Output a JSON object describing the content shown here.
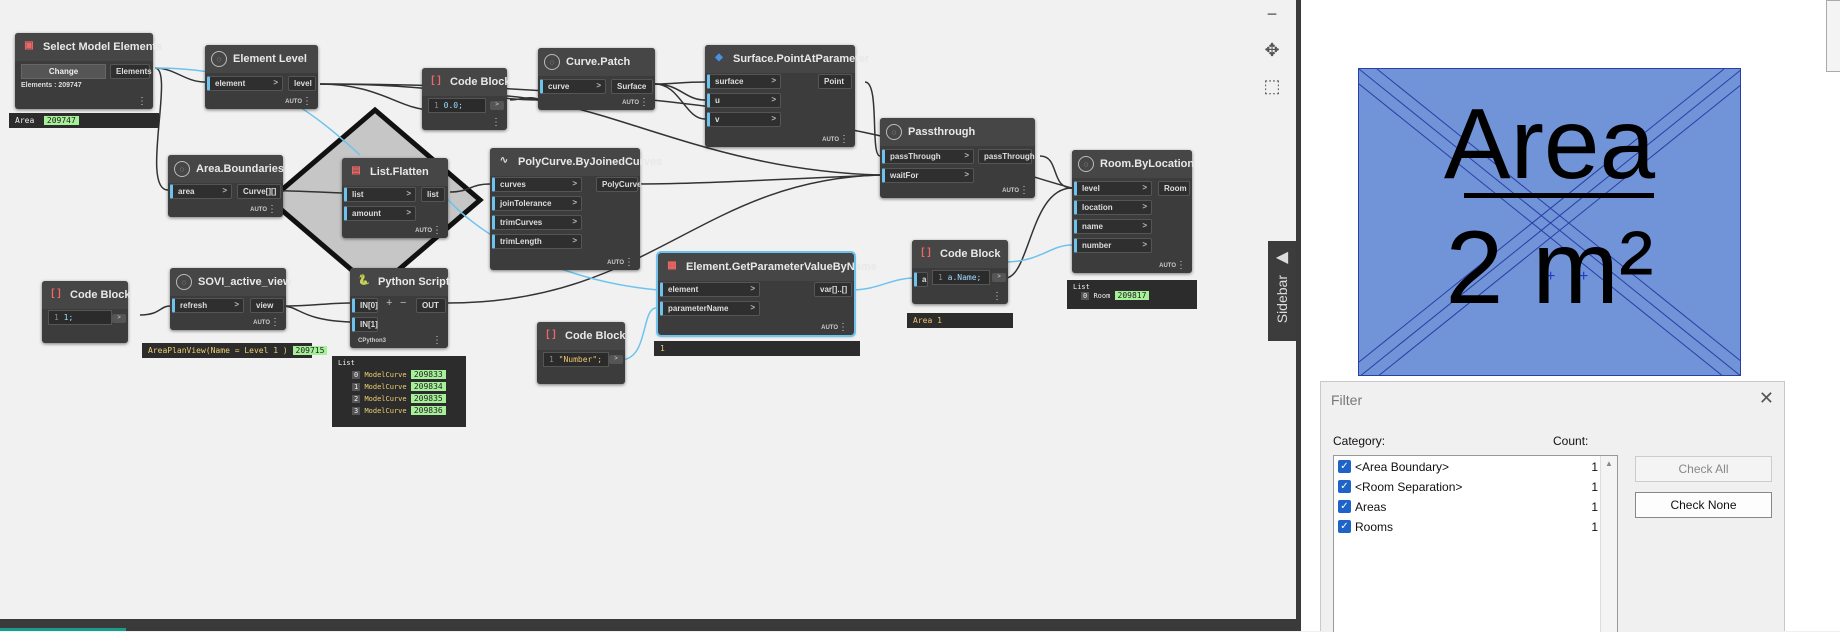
{
  "nodes": {
    "select_model_elements": {
      "title": "Select Model Elements",
      "button": "Change",
      "output": "Elements",
      "info": "Elements : 209747"
    },
    "element_level": {
      "title": "Element Level",
      "input": "element",
      "output": "level",
      "auto": "AUTO"
    },
    "code_block_1": {
      "title": "Code Block",
      "code": "0.0;"
    },
    "curve_patch": {
      "title": "Curve.Patch",
      "input": "curve",
      "output": "Surface",
      "auto": "AUTO"
    },
    "surface_point": {
      "title": "Surface.PointAtParameter",
      "inputs": [
        "surface",
        "u",
        "v"
      ],
      "output": "Point",
      "auto": "AUTO"
    },
    "passthrough": {
      "title": "Passthrough",
      "inputs": [
        "passThrough",
        "waitFor"
      ],
      "output": "passThrough",
      "auto": "AUTO"
    },
    "room_by_location": {
      "title": "Room.ByLocation",
      "inputs": [
        "level",
        "location",
        "name",
        "number"
      ],
      "output": "Room",
      "auto": "AUTO"
    },
    "area_boundaries": {
      "title": "Area.Boundaries",
      "input": "area",
      "output": "Curve[][]",
      "auto": "AUTO"
    },
    "list_flatten": {
      "title": "List.Flatten",
      "inputs": [
        "list",
        "amount"
      ],
      "output": "list",
      "auto": "AUTO"
    },
    "polycurve": {
      "title": "PolyCurve.ByJoinedCurves",
      "inputs": [
        "curves",
        "joinTolerance",
        "trimCurves",
        "trimLength"
      ],
      "output": "PolyCurve",
      "auto": "AUTO"
    },
    "code_block_2": {
      "title": "Code Block",
      "code": "1;"
    },
    "sovi": {
      "title": "SOVI_active_view",
      "input": "refresh",
      "output": "view",
      "auto": "AUTO"
    },
    "python_script": {
      "title": "Python Script",
      "inputs": [
        "IN[0]",
        "IN[1]"
      ],
      "output": "OUT",
      "footer": "CPython3"
    },
    "code_block_3": {
      "title": "Code Block",
      "code": "\"Number\";"
    },
    "get_param": {
      "title": "Element.GetParameterValueByName",
      "inputs": [
        "element",
        "parameterName"
      ],
      "output": "var[]..[]",
      "auto": "AUTO"
    },
    "code_block_4": {
      "title": "Code Block",
      "input": "a",
      "code": "a.Name;"
    }
  },
  "watches": {
    "area": {
      "label": "Area",
      "value": "209747"
    },
    "view": {
      "label": "AreaPlanView(Name = Level 1 )",
      "value": "209715"
    },
    "list_header": "List",
    "model_curves": [
      {
        "index": "0",
        "label": "ModelCurve",
        "value": "209833"
      },
      {
        "index": "1",
        "label": "ModelCurve",
        "value": "209834"
      },
      {
        "index": "2",
        "label": "ModelCurve",
        "value": "209835"
      },
      {
        "index": "3",
        "label": "ModelCurve",
        "value": "209836"
      }
    ],
    "param_value": "1",
    "name_value": "Area 1",
    "room_list_header": "List",
    "room": {
      "index": "0",
      "label": "Room",
      "value": "209817"
    }
  },
  "canvas": {
    "sidebar_label": "Sidebar"
  },
  "revit": {
    "area_name": "Area",
    "area_value": "2 m²"
  },
  "filter": {
    "title": "Filter",
    "category_label": "Category:",
    "count_label": "Count:",
    "items": [
      {
        "label": "<Area Boundary>",
        "count": "1",
        "checked": true
      },
      {
        "label": "<Room Separation>",
        "count": "1",
        "checked": true
      },
      {
        "label": "Areas",
        "count": "1",
        "checked": true
      },
      {
        "label": "Rooms",
        "count": "1",
        "checked": true
      }
    ],
    "check_all": "Check All",
    "check_none": "Check None"
  },
  "icons": [
    "minus-icon",
    "pan-icon",
    "zoom-extents-icon",
    "close-icon",
    "checkbox-icon",
    "scroll-up-icon",
    "sidebar-arrow-icon"
  ],
  "colors": {
    "selection": "#6dc3ee",
    "watch_highlight": "#a7f09a",
    "area_fill": "#7193d8"
  }
}
